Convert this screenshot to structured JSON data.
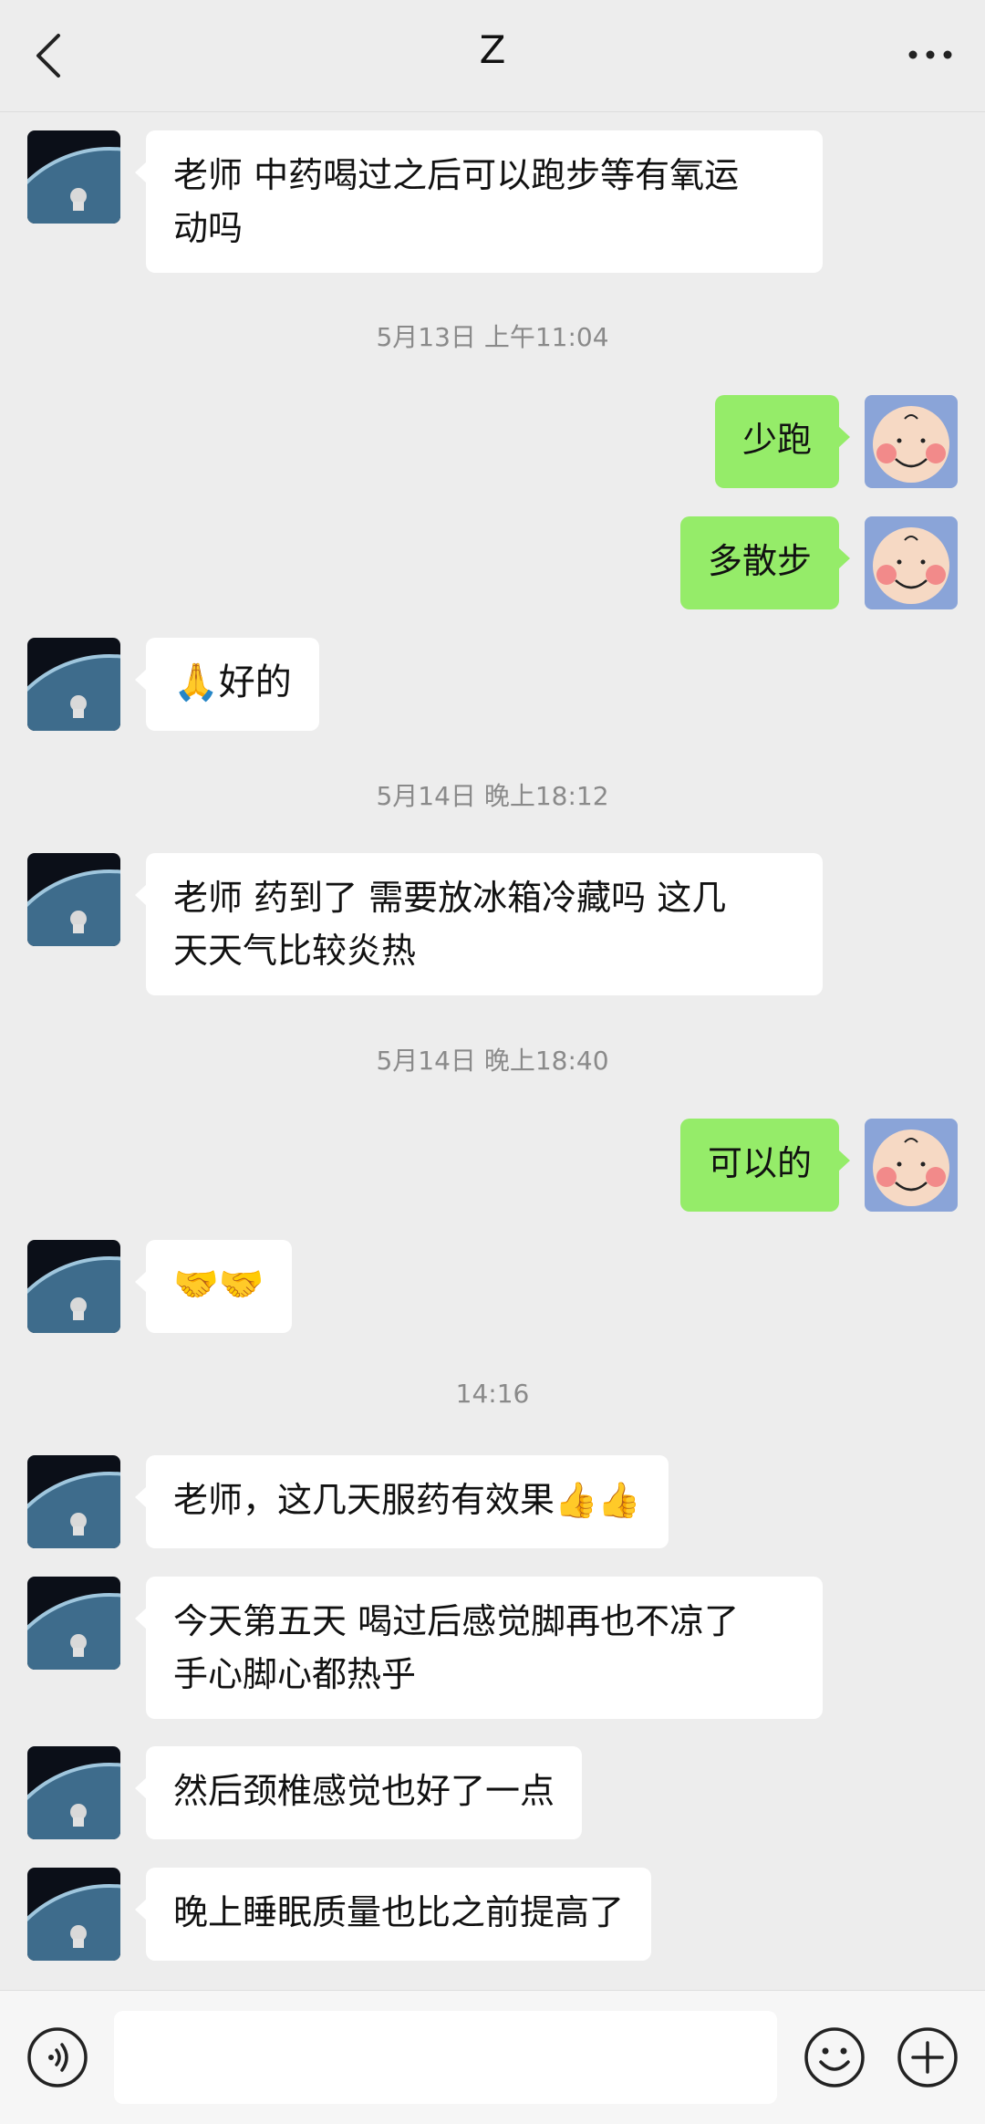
{
  "header": {
    "title": "Z",
    "back_icon": "chevron-left-icon",
    "more_icon": "more-dots-icon"
  },
  "messages": [
    {
      "side": "left",
      "text_lines": [
        "老师 中药喝过之后可以跑步等有氧运",
        "动吗"
      ]
    },
    {
      "timestamp": "5月13日 上午11:04"
    },
    {
      "side": "right",
      "text_lines": [
        "少跑"
      ]
    },
    {
      "side": "right",
      "text_lines": [
        "多散步"
      ]
    },
    {
      "side": "left",
      "text_lines": [
        "🙏好的"
      ]
    },
    {
      "timestamp": "5月14日 晚上18:12"
    },
    {
      "side": "left",
      "text_lines": [
        "老师 药到了 需要放冰箱冷藏吗 这几",
        "天天气比较炎热"
      ]
    },
    {
      "timestamp": "5月14日 晚上18:40"
    },
    {
      "side": "right",
      "text_lines": [
        "可以的"
      ]
    },
    {
      "side": "left",
      "text_lines": [
        "🤝🤝"
      ]
    },
    {
      "timestamp": "14:16"
    },
    {
      "side": "left",
      "text_lines": [
        "老师，这几天服药有效果👍👍"
      ]
    },
    {
      "side": "left",
      "text_lines": [
        "今天第五天 喝过后感觉脚再也不凉了",
        "手心脚心都热乎"
      ]
    },
    {
      "side": "left",
      "text_lines": [
        "然后颈椎感觉也好了一点"
      ]
    },
    {
      "side": "left",
      "text_lines": [
        "晚上睡眠质量也比之前提高了"
      ]
    }
  ],
  "input_bar": {
    "voice_icon": "voice-icon",
    "input_value": "",
    "emoji_icon": "emoji-icon",
    "plus_icon": "plus-icon"
  },
  "colors": {
    "background": "#ededed",
    "bubble_left": "#ffffff",
    "bubble_right": "#95ec69",
    "timestamp": "#8a8a8a"
  }
}
